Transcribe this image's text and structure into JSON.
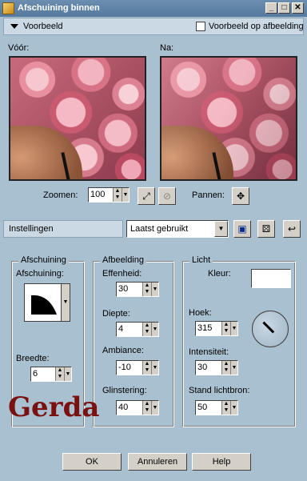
{
  "window": {
    "title": "Afschuining binnen"
  },
  "title_buttons": {
    "minimize": "_",
    "maximize": "□",
    "close": "✕"
  },
  "preview_section": {
    "label": "Voorbeeld",
    "checkbox_label": "Voorbeeld op afbeelding",
    "before_label": "Vóór:",
    "after_label": "Na:"
  },
  "zoom": {
    "label": "Zoomen:",
    "value": "100",
    "pan_label": "Pannen:"
  },
  "settings": {
    "label": "Instellingen",
    "preset_value": "Laatst gebruikt"
  },
  "afschuining": {
    "legend": "Afschuining",
    "sub_label": "Afschuining:",
    "width_label": "Breedte:",
    "width_value": "6"
  },
  "afbeelding": {
    "legend": "Afbeelding",
    "effenheid_label": "Effenheid:",
    "effenheid_value": "30",
    "diepte_label": "Diepte:",
    "diepte_value": "4",
    "ambiance_label": "Ambiance:",
    "ambiance_value": "-10",
    "glinstering_label": "Glinstering:",
    "glinstering_value": "40"
  },
  "licht": {
    "legend": "Licht",
    "kleur_label": "Kleur:",
    "hoek_label": "Hoek:",
    "hoek_value": "315",
    "intensiteit_label": "Intensiteit:",
    "intensiteit_value": "30",
    "stand_label": "Stand lichtbron:",
    "stand_value": "50",
    "color": "#ffffff"
  },
  "watermark": "Gerda",
  "buttons": {
    "ok": "OK",
    "cancel": "Annuleren",
    "help": "Help"
  }
}
